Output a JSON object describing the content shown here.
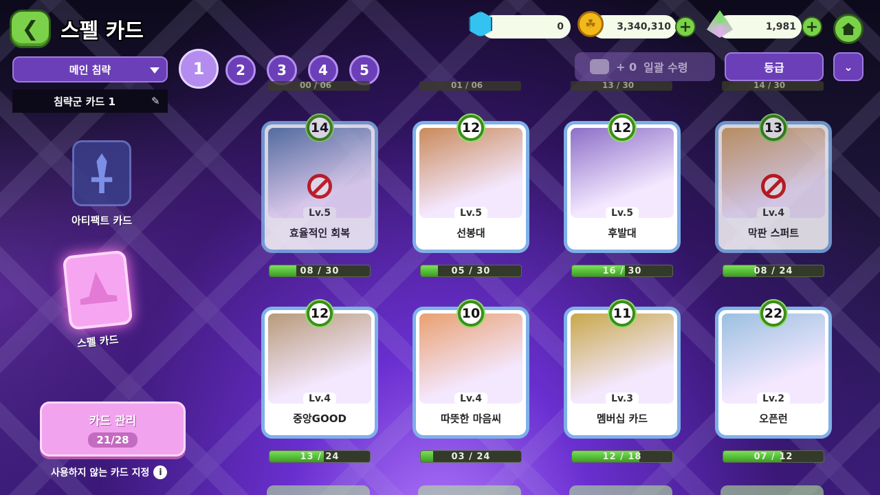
{
  "header": {
    "title": "스펠 카드",
    "back_icon": "chevron-left-icon",
    "resources": [
      {
        "name": "gem",
        "value": "0",
        "icon": "gem-icon"
      },
      {
        "name": "coin",
        "value": "3,340,310",
        "icon": "coin-icon"
      },
      {
        "name": "leaf",
        "value": "1,981",
        "icon": "leaf-icon"
      }
    ],
    "home_icon": "home-icon"
  },
  "deck": {
    "selected": "메인 침략",
    "tabs": [
      "1",
      "2",
      "3",
      "4",
      "5"
    ],
    "active_tab": "1",
    "deck_name": "침략군 카드 1"
  },
  "toolbar": {
    "bulk_count": "+ 0",
    "bulk_label": "일괄 수령",
    "grade_label": "등급",
    "sort_icon": "double-chevron-down-icon"
  },
  "sidebar": {
    "artifact_label": "아티팩트 카드",
    "spell_label": "스펠 카드"
  },
  "manage": {
    "label": "카드 관리",
    "count": "21/28",
    "unused_label": "사용하지 않는 카드 지정"
  },
  "top_peek": [
    "00 / 06",
    "01 / 06",
    "13 / 30",
    "14 / 30"
  ],
  "cards": [
    {
      "badge": "14",
      "lv": "Lv.5",
      "name": "효율적인 회복",
      "progress": "08 / 30",
      "fill": 0.27,
      "blocked": true,
      "bg": "#5c7fb0"
    },
    {
      "badge": "12",
      "lv": "Lv.5",
      "name": "선봉대",
      "progress": "05 / 30",
      "fill": 0.17,
      "blocked": false,
      "bg": "#c98a5a"
    },
    {
      "badge": "12",
      "lv": "Lv.5",
      "name": "후발대",
      "progress": "16 / 30",
      "fill": 0.53,
      "blocked": false,
      "bg": "#8d6fc8"
    },
    {
      "badge": "13",
      "lv": "Lv.4",
      "name": "막판 스퍼트",
      "progress": "08 / 24",
      "fill": 0.33,
      "blocked": true,
      "bg": "#d8a86a"
    },
    {
      "badge": "12",
      "lv": "Lv.4",
      "name": "중앙GOOD",
      "progress": "13 / 24",
      "fill": 0.54,
      "blocked": false,
      "bg": "#b89a7a"
    },
    {
      "badge": "10",
      "lv": "Lv.4",
      "name": "따뜻한 마음씨",
      "progress": "03 / 24",
      "fill": 0.12,
      "blocked": false,
      "bg": "#e9a070"
    },
    {
      "badge": "11",
      "lv": "Lv.3",
      "name": "멤버십 카드",
      "progress": "12 / 18",
      "fill": 0.67,
      "blocked": false,
      "bg": "#c8a84a"
    },
    {
      "badge": "22",
      "lv": "Lv.2",
      "name": "오픈런",
      "progress": "07 / 12",
      "fill": 0.58,
      "blocked": false,
      "bg": "#9ac0e0"
    }
  ]
}
